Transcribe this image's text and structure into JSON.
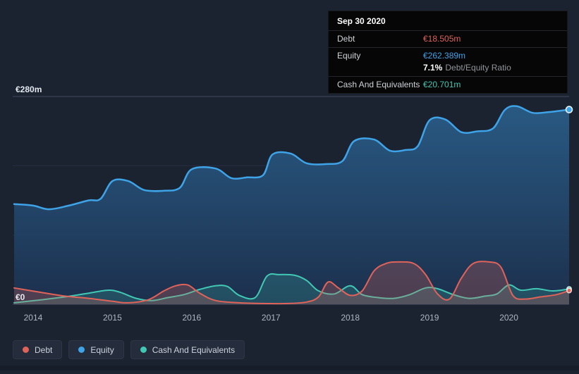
{
  "colors": {
    "background": "#1b2230",
    "debt": "#e0635a",
    "equity": "#3fa3e8",
    "cash": "#41c8b4",
    "tooltip_bg": "#060607",
    "grid_strong": "#404a5f",
    "grid_faint": "#272e40"
  },
  "tooltip": {
    "date": "Sep 30 2020",
    "debt_label": "Debt",
    "debt_value": "€18.505m",
    "equity_label": "Equity",
    "equity_value": "€262.389m",
    "ratio_value": "7.1%",
    "ratio_label": "Debt/Equity Ratio",
    "cash_label": "Cash And Equivalents",
    "cash_value": "€20.701m"
  },
  "legend": [
    {
      "label": "Debt"
    },
    {
      "label": "Equity"
    },
    {
      "label": "Cash And Equivalents"
    }
  ],
  "chart_data": {
    "type": "area",
    "title": "",
    "xlabel": "",
    "ylabel": "",
    "x_range": [
      2013.76,
      2020.76
    ],
    "ylim": [
      0,
      280
    ],
    "grid": "horizontal",
    "legend_position": "bottom-left",
    "y_ticks": [
      {
        "value": 280,
        "label": "€280m"
      },
      {
        "value": 0,
        "label": "€0"
      }
    ],
    "x_ticks": [
      {
        "value": 2014,
        "label": "2014"
      },
      {
        "value": 2015,
        "label": "2015"
      },
      {
        "value": 2016,
        "label": "2016"
      },
      {
        "value": 2017,
        "label": "2017"
      },
      {
        "value": 2018,
        "label": "2018"
      },
      {
        "value": 2019,
        "label": "2019"
      },
      {
        "value": 2020,
        "label": "2020"
      }
    ],
    "series": [
      {
        "name": "Debt",
        "unit": "€m",
        "x": [
          2013.76,
          2014.1,
          2014.4,
          2014.7,
          2015.0,
          2015.2,
          2015.45,
          2015.65,
          2015.8,
          2015.95,
          2016.1,
          2016.3,
          2016.6,
          2016.9,
          2017.2,
          2017.45,
          2017.6,
          2017.72,
          2017.85,
          2018.0,
          2018.15,
          2018.3,
          2018.45,
          2018.6,
          2018.8,
          2018.95,
          2019.1,
          2019.25,
          2019.4,
          2019.55,
          2019.75,
          2019.9,
          2020.05,
          2020.2,
          2020.4,
          2020.6,
          2020.76
        ],
        "values": [
          22,
          16,
          11,
          8,
          4,
          2,
          6,
          18,
          25,
          26,
          15,
          5,
          2,
          1,
          1,
          3,
          10,
          30,
          22,
          12,
          18,
          45,
          55,
          57,
          55,
          40,
          14,
          7,
          35,
          55,
          57,
          50,
          12,
          7,
          10,
          13,
          18.505
        ]
      },
      {
        "name": "Equity",
        "unit": "€m",
        "x": [
          2013.76,
          2014.0,
          2014.2,
          2014.45,
          2014.7,
          2014.85,
          2015.0,
          2015.2,
          2015.4,
          2015.65,
          2015.85,
          2016.0,
          2016.3,
          2016.5,
          2016.7,
          2016.9,
          2017.02,
          2017.25,
          2017.45,
          2017.7,
          2017.9,
          2018.05,
          2018.3,
          2018.5,
          2018.7,
          2018.85,
          2019.0,
          2019.2,
          2019.4,
          2019.6,
          2019.8,
          2019.95,
          2020.1,
          2020.3,
          2020.5,
          2020.76
        ],
        "values": [
          135,
          133,
          128,
          133,
          140,
          142,
          166,
          166,
          154,
          153,
          157,
          182,
          183,
          170,
          171,
          174,
          202,
          203,
          190,
          189,
          193,
          220,
          222,
          207,
          208,
          213,
          248,
          249,
          232,
          233,
          237,
          262,
          267,
          258,
          259,
          262.389
        ]
      },
      {
        "name": "Cash And Equivalents",
        "unit": "€m",
        "x": [
          2013.76,
          2014.1,
          2014.4,
          2014.7,
          2014.95,
          2015.1,
          2015.3,
          2015.5,
          2015.7,
          2015.9,
          2016.1,
          2016.3,
          2016.45,
          2016.6,
          2016.8,
          2016.95,
          2017.1,
          2017.3,
          2017.45,
          2017.6,
          2017.8,
          2018.0,
          2018.15,
          2018.35,
          2018.55,
          2018.75,
          2018.95,
          2019.1,
          2019.3,
          2019.5,
          2019.7,
          2019.85,
          2020.0,
          2020.15,
          2020.35,
          2020.55,
          2020.76
        ],
        "values": [
          2,
          6,
          10,
          15,
          19,
          16,
          8,
          5,
          9,
          13,
          20,
          25,
          24,
          12,
          9,
          38,
          40,
          39,
          32,
          18,
          14,
          25,
          13,
          9,
          8,
          13,
          22,
          21,
          13,
          8,
          11,
          14,
          26,
          19,
          21,
          18,
          20.701
        ]
      }
    ]
  }
}
